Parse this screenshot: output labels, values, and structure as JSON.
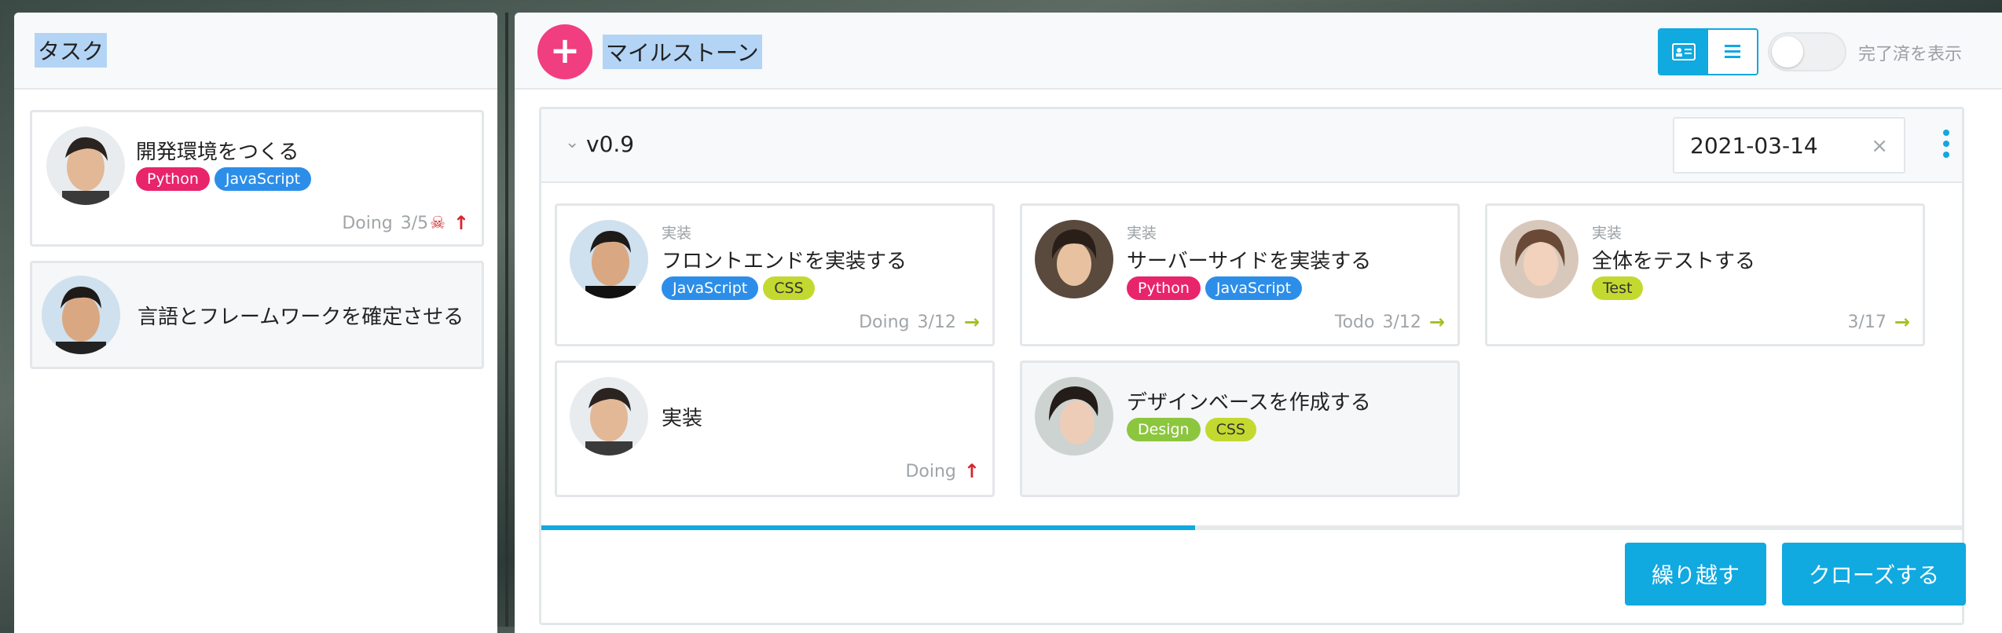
{
  "tasks_panel": {
    "title": "タスク",
    "cards": [
      {
        "title": "開発環境をつくる",
        "tags": [
          {
            "label": "Python",
            "color": "#e8246a"
          },
          {
            "label": "JavaScript",
            "color": "#2c8ee8"
          }
        ],
        "status": "Doing",
        "count": "3/5"
      },
      {
        "title": "言語とフレームワークを確定させる"
      }
    ]
  },
  "milestone_panel": {
    "title": "マイルストーン",
    "add_icon": "plus-icon",
    "show_completed_label": "完了済を表示",
    "milestone": {
      "name": "v0.9",
      "due_date": "2021-03-14",
      "progress_fraction": 0.46,
      "cards": [
        {
          "category": "実装",
          "title": "フロントエンドを実装する",
          "tags": [
            {
              "label": "JavaScript",
              "color": "#2c8ee8"
            },
            {
              "label": "CSS",
              "color": "#c3d930"
            }
          ],
          "status": "Doing",
          "count": "3/12"
        },
        {
          "category": "実装",
          "title": "サーバーサイドを実装する",
          "tags": [
            {
              "label": "Python",
              "color": "#e8246a"
            },
            {
              "label": "JavaScript",
              "color": "#2c8ee8"
            }
          ],
          "status": "Todo",
          "count": "3/12"
        },
        {
          "category": "実装",
          "title": "全体をテストする",
          "tags": [
            {
              "label": "Test",
              "color": "#c3d930"
            }
          ],
          "status": "",
          "count": "3/17"
        },
        {
          "title": "実装",
          "status": "Doing"
        },
        {
          "title": "デザインベースを作成する",
          "tags": [
            {
              "label": "Design",
              "color": "#8cc63f"
            },
            {
              "label": "CSS",
              "color": "#c3d930"
            }
          ]
        }
      ],
      "carry_over_label": "繰り越す",
      "close_label": "クローズする"
    }
  },
  "colors": {
    "accent": "#10a9e0",
    "add_button": "#f03e80",
    "danger": "#d6262e",
    "next": "#a9bd22"
  }
}
